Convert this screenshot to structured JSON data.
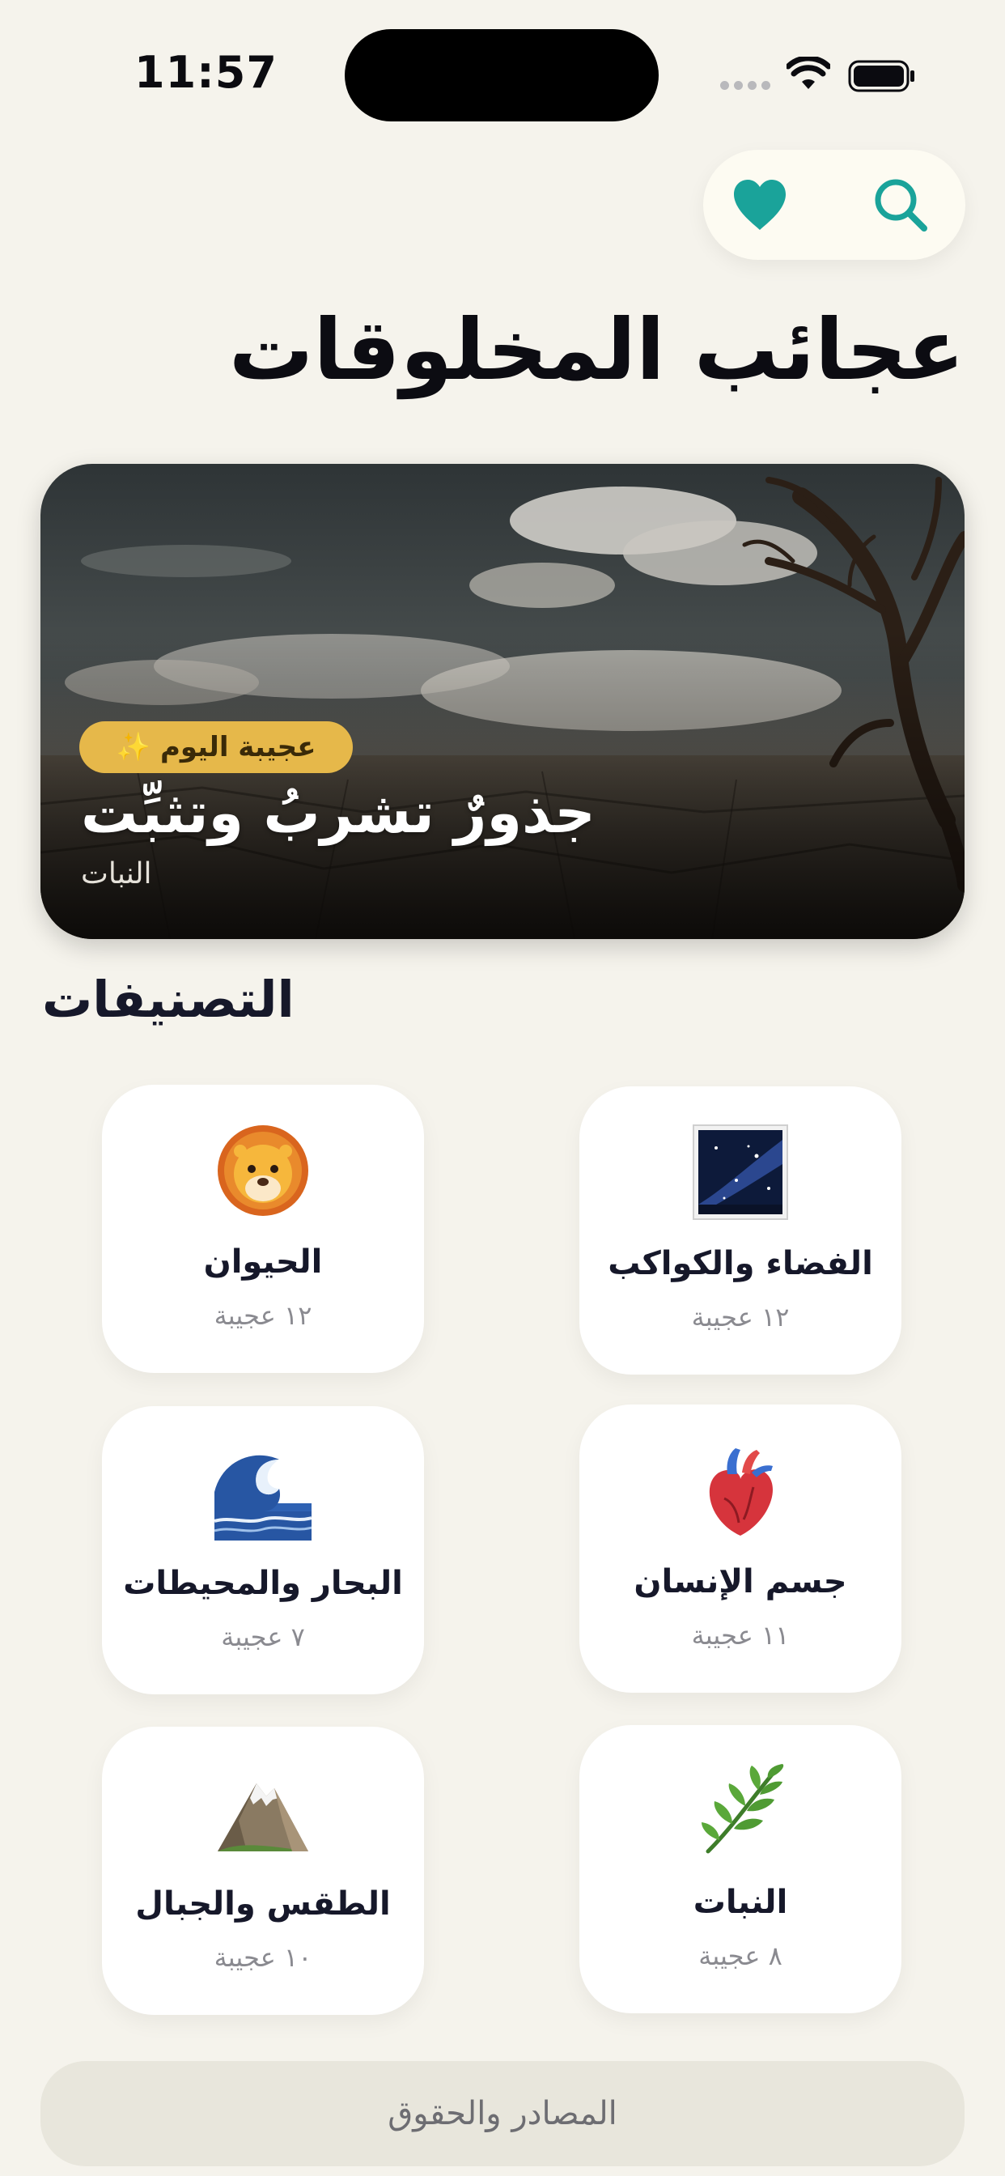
{
  "status_bar": {
    "time": "11:57"
  },
  "header": {
    "favorites_icon": "heart-icon",
    "search_icon": "search-icon",
    "accent_color": "#1aa39a",
    "title": "عجائب المخلوقات"
  },
  "featured": {
    "badge_label": "عجيبة اليوم",
    "badge_icon": "sparkles-icon",
    "badge_color": "#e6b84a",
    "title": "جذورٌ تشربُ وتثبِّت",
    "category": "النبات"
  },
  "categories_section": {
    "title": "التصنيفات",
    "items": [
      {
        "name": "الحيوان",
        "count": "١٢ عجيبة",
        "icon": "lion-icon"
      },
      {
        "name": "الفضاء والكواكب",
        "count": "١٢ عجيبة",
        "icon": "milky-way-icon"
      },
      {
        "name": "البحار والمحيطات",
        "count": "٧ عجيبة",
        "icon": "water-wave-icon"
      },
      {
        "name": "جسم الإنسان",
        "count": "١١ عجيبة",
        "icon": "anatomical-heart-icon"
      },
      {
        "name": "الطقس والجبال",
        "count": "١٠ عجيبة",
        "icon": "mountain-icon"
      },
      {
        "name": "النبات",
        "count": "٨ عجيبة",
        "icon": "herb-icon"
      }
    ]
  },
  "footer": {
    "sources_label": "المصادر والحقوق"
  }
}
